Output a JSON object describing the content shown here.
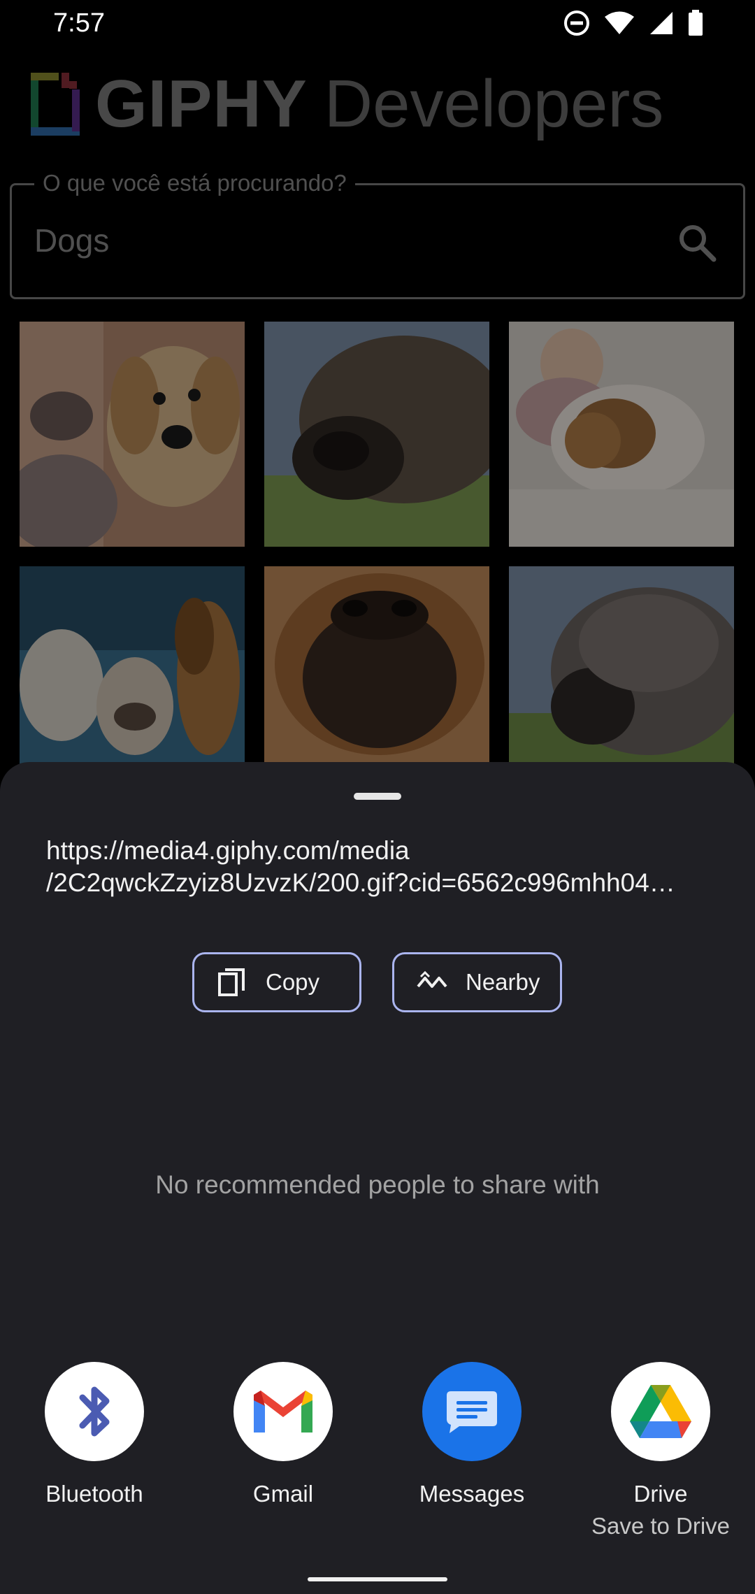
{
  "status_bar": {
    "time": "7:57",
    "icons": [
      "do-not-disturb-icon",
      "wifi-icon",
      "signal-icon",
      "battery-icon"
    ]
  },
  "app": {
    "logo_brand": "GIPHY",
    "logo_suffix": "Developers",
    "search": {
      "label": "O que você está procurando?",
      "value": "Dogs"
    },
    "results": [
      {
        "name": "gif-golden-retriever"
      },
      {
        "name": "gif-dog-close-up"
      },
      {
        "name": "gif-baby-with-puppy"
      },
      {
        "name": "gif-group-of-dogs"
      },
      {
        "name": "gif-boxer-dog-nose"
      },
      {
        "name": "gif-gray-dog"
      }
    ]
  },
  "share_sheet": {
    "url_line1": "https://media4.giphy.com/media",
    "url_line2": "/2C2qwckZzyiz8UzvzK/200.gif?cid=6562c996mhh04…",
    "copy_label": "Copy",
    "nearby_label": "Nearby",
    "no_recommendations": "No recommended people to share with",
    "targets": [
      {
        "label": "Bluetooth",
        "icon": "bluetooth-icon"
      },
      {
        "label": "Gmail",
        "icon": "gmail-icon"
      },
      {
        "label": "Messages",
        "icon": "messages-icon"
      },
      {
        "label": "Drive",
        "sublabel": "Save to Drive",
        "icon": "drive-icon"
      }
    ]
  },
  "colors": {
    "sheet_bg": "#1f1f24",
    "button_outline": "#aab4ee",
    "messages_blue": "#1a73e8"
  }
}
